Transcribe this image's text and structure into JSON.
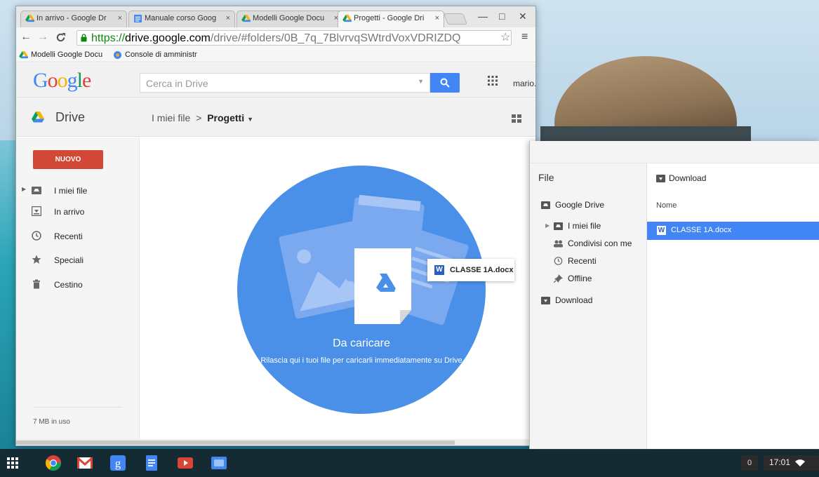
{
  "browser": {
    "tabs": [
      {
        "label": "In arrivo - Google Dr",
        "close": "×",
        "favicon": "drive-icon"
      },
      {
        "label": "Manuale corso Goog",
        "close": "×",
        "favicon": "docs-icon"
      },
      {
        "label": "Modelli Google Docu",
        "close": "×",
        "favicon": "drive-icon"
      },
      {
        "label": "Progetti - Google Dri",
        "close": "×",
        "favicon": "drive-icon",
        "active": true
      }
    ],
    "window_controls": {
      "minimize": "—",
      "maximize": "□",
      "close": "✕"
    },
    "url": {
      "scheme": "https://",
      "host": "drive.google.com",
      "path": "/drive/#folders/0B_7q_7BlvrvqSWtrdVoxVDRIZDQ"
    },
    "bookmarks": [
      {
        "label": "Modelli Google Docu",
        "favicon": "drive-icon"
      },
      {
        "label": "Console di amministr",
        "favicon": "admin-icon"
      }
    ]
  },
  "drive": {
    "logo": "Google",
    "search_placeholder": "Cerca in Drive",
    "user": "mario.",
    "app_title": "Drive",
    "breadcrumb": {
      "root": "I miei file",
      "separator": ">",
      "current": "Progetti"
    },
    "new_button": "NUOVO",
    "nav": [
      {
        "label": "I miei file",
        "icon": "my-drive-icon"
      },
      {
        "label": "In arrivo",
        "icon": "incoming-icon"
      },
      {
        "label": "Recenti",
        "icon": "clock-icon"
      },
      {
        "label": "Speciali",
        "icon": "star-icon"
      },
      {
        "label": "Cestino",
        "icon": "trash-icon"
      }
    ],
    "storage": "7 MB in uso",
    "drop_zone": {
      "title": "Da caricare",
      "subtitle": "Rilascia qui i tuoi file per caricarli immediatamente su Drive",
      "dragged_file": "CLASSE 1A.docx"
    }
  },
  "file_dialog": {
    "title": "File",
    "sidebar": [
      {
        "label": "Google Drive",
        "icon": "drive-folder-icon"
      },
      {
        "label": "I miei file",
        "icon": "my-drive-icon"
      },
      {
        "label": "Condivisi con me",
        "icon": "shared-icon"
      },
      {
        "label": "Recenti",
        "icon": "clock-icon"
      },
      {
        "label": "Offline",
        "icon": "pin-icon"
      },
      {
        "label": "Download",
        "icon": "download-folder-icon"
      }
    ],
    "current_folder": "Download",
    "column_header": "Nome",
    "files": [
      {
        "name": "CLASSE 1A.docx",
        "selected": true
      }
    ]
  },
  "shelf": {
    "apps": [
      "chrome-icon",
      "gmail-icon",
      "google-plus-icon",
      "docs-icon",
      "youtube-icon",
      "files-icon"
    ],
    "notification_count": "0",
    "time": "17:01"
  },
  "colors": {
    "accent": "#4285f4",
    "new_button": "#d14836",
    "drop_circle": "#4a8fe8"
  }
}
